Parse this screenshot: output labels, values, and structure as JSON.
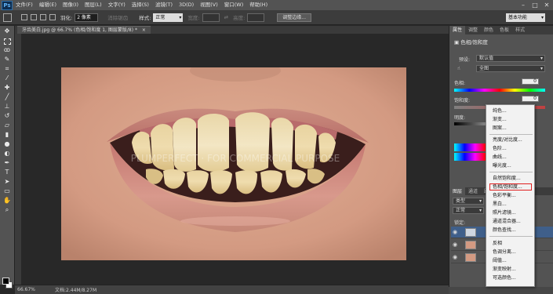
{
  "menubar": {
    "app_logo": "Ps",
    "items": [
      "文件(F)",
      "编辑(E)",
      "图像(I)",
      "图层(L)",
      "文字(Y)",
      "选择(S)",
      "滤镜(T)",
      "3D(D)",
      "视图(V)",
      "窗口(W)",
      "帮助(H)"
    ],
    "window_controls": [
      "–",
      "□",
      "✕"
    ]
  },
  "optbar": {
    "feather_label": "羽化:",
    "feather_value": "2 像素",
    "antialias_label": "消除锯齿",
    "style_label": "样式:",
    "style_value": "正常",
    "width_label": "宽度:",
    "height_label": "高度:",
    "refine_edge_button": "调整边缘...",
    "workspace_value": "基本功能"
  },
  "document": {
    "tab_title": "牙齿美白.jpg @ 66.7% (色相/饱和度 1, 图层蒙版/8) *",
    "close_glyph": "×"
  },
  "status": {
    "zoom": "66.67%",
    "doc_info": "文档:2.44M/8.27M"
  },
  "properties_panel": {
    "tabs": [
      "属性",
      "调整",
      "颜色",
      "色板",
      "样式"
    ],
    "title": "色相/饱和度",
    "preset_label": "预设:",
    "preset_value": "默认值",
    "channel_value": "全图",
    "hue_label": "色相:",
    "hue_value": "0",
    "saturation_label": "饱和度:",
    "saturation_value": "0",
    "lightness_label": "明度:",
    "lightness_value": "0"
  },
  "layers_panel": {
    "tabs": [
      "图层",
      "通道",
      "路径"
    ],
    "kind_label": "类型",
    "blend_mode": "正常",
    "lock_label": "锁定:"
  },
  "adjustment_menu": {
    "groups": [
      [
        "纯色...",
        "渐变...",
        "图案..."
      ],
      [
        "亮度/对比度...",
        "色阶...",
        "曲线...",
        "曝光度..."
      ],
      [
        "自然饱和度...",
        "色相/饱和度...",
        "色彩平衡...",
        "黑白...",
        "照片滤镜...",
        "通道混合器...",
        "颜色查找..."
      ],
      [
        "反相",
        "色调分离...",
        "阈值...",
        "渐变映射...",
        "可选颜色..."
      ]
    ],
    "highlighted_item": "色相/饱和度..."
  },
  "watermark": {
    "text": "PLUMPERFECT · FOR COMMERCIAL PURPOSE"
  },
  "colors": {
    "menubar_bg": "#535353",
    "canvas_bg": "#282828",
    "highlight_outline": "#e02020",
    "skin": "#d39a82",
    "lip": "#c67c74"
  }
}
